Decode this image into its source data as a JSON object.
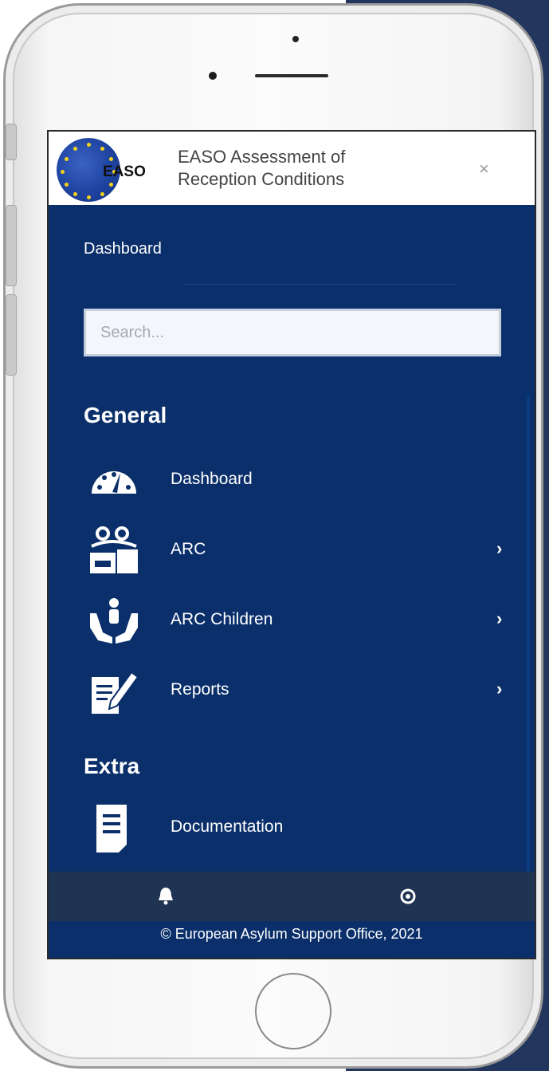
{
  "header": {
    "logo_text": "EASO",
    "title_line1": "EASO Assessment of",
    "title_line2": "Reception Conditions",
    "close_label": "×"
  },
  "breadcrumb": "Dashboard",
  "search": {
    "placeholder": "Search..."
  },
  "sections": {
    "general": "General",
    "extra": "Extra"
  },
  "nav": {
    "dashboard": {
      "label": "Dashboard",
      "icon": "speedometer-icon"
    },
    "arc": {
      "label": "ARC",
      "icon": "assessment-icon",
      "chevron": "›"
    },
    "arc_children": {
      "label": "ARC Children",
      "icon": "child-hands-icon",
      "chevron": "›"
    },
    "reports": {
      "label": "Reports",
      "icon": "report-edit-icon",
      "chevron": "›"
    },
    "documentation": {
      "label": "Documentation",
      "icon": "document-icon"
    }
  },
  "footer": {
    "copyright": "© European Asylum Support Office, 2021",
    "bell_icon": "bell-icon",
    "settings_icon": "gear-icon"
  },
  "colors": {
    "sidebar_bg": "#0a2f6a",
    "footer_bg": "#1f3352",
    "header_bg": "#ffffff"
  }
}
